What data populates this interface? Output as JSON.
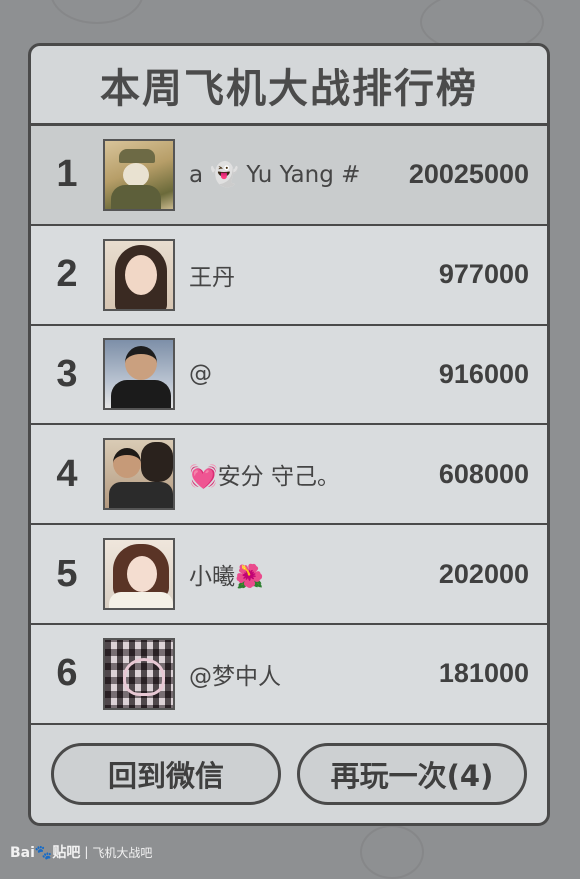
{
  "title": "本周飞机大战排行榜",
  "leaderboard": [
    {
      "rank": "1",
      "name": "a 👻 Yu Yang #",
      "score": "20025000"
    },
    {
      "rank": "2",
      "name": "王丹",
      "score": "977000"
    },
    {
      "rank": "3",
      "name": "@",
      "score": "916000"
    },
    {
      "rank": "4",
      "name": "💓安分   守己。",
      "score": "608000"
    },
    {
      "rank": "5",
      "name": "小曦🌺",
      "score": "202000"
    },
    {
      "rank": "6",
      "name": "@梦中人",
      "score": "181000"
    }
  ],
  "buttons": {
    "back": "回到微信",
    "replay": "再玩一次(4)"
  },
  "watermark": {
    "logo": "Bai🐾贴吧",
    "separator": "|",
    "forum": "飞机大战吧"
  },
  "colors": {
    "panel": "#d4d7d9",
    "border": "#4a4a4a",
    "background": "#8e9092",
    "first_row": "#c9cccd"
  }
}
